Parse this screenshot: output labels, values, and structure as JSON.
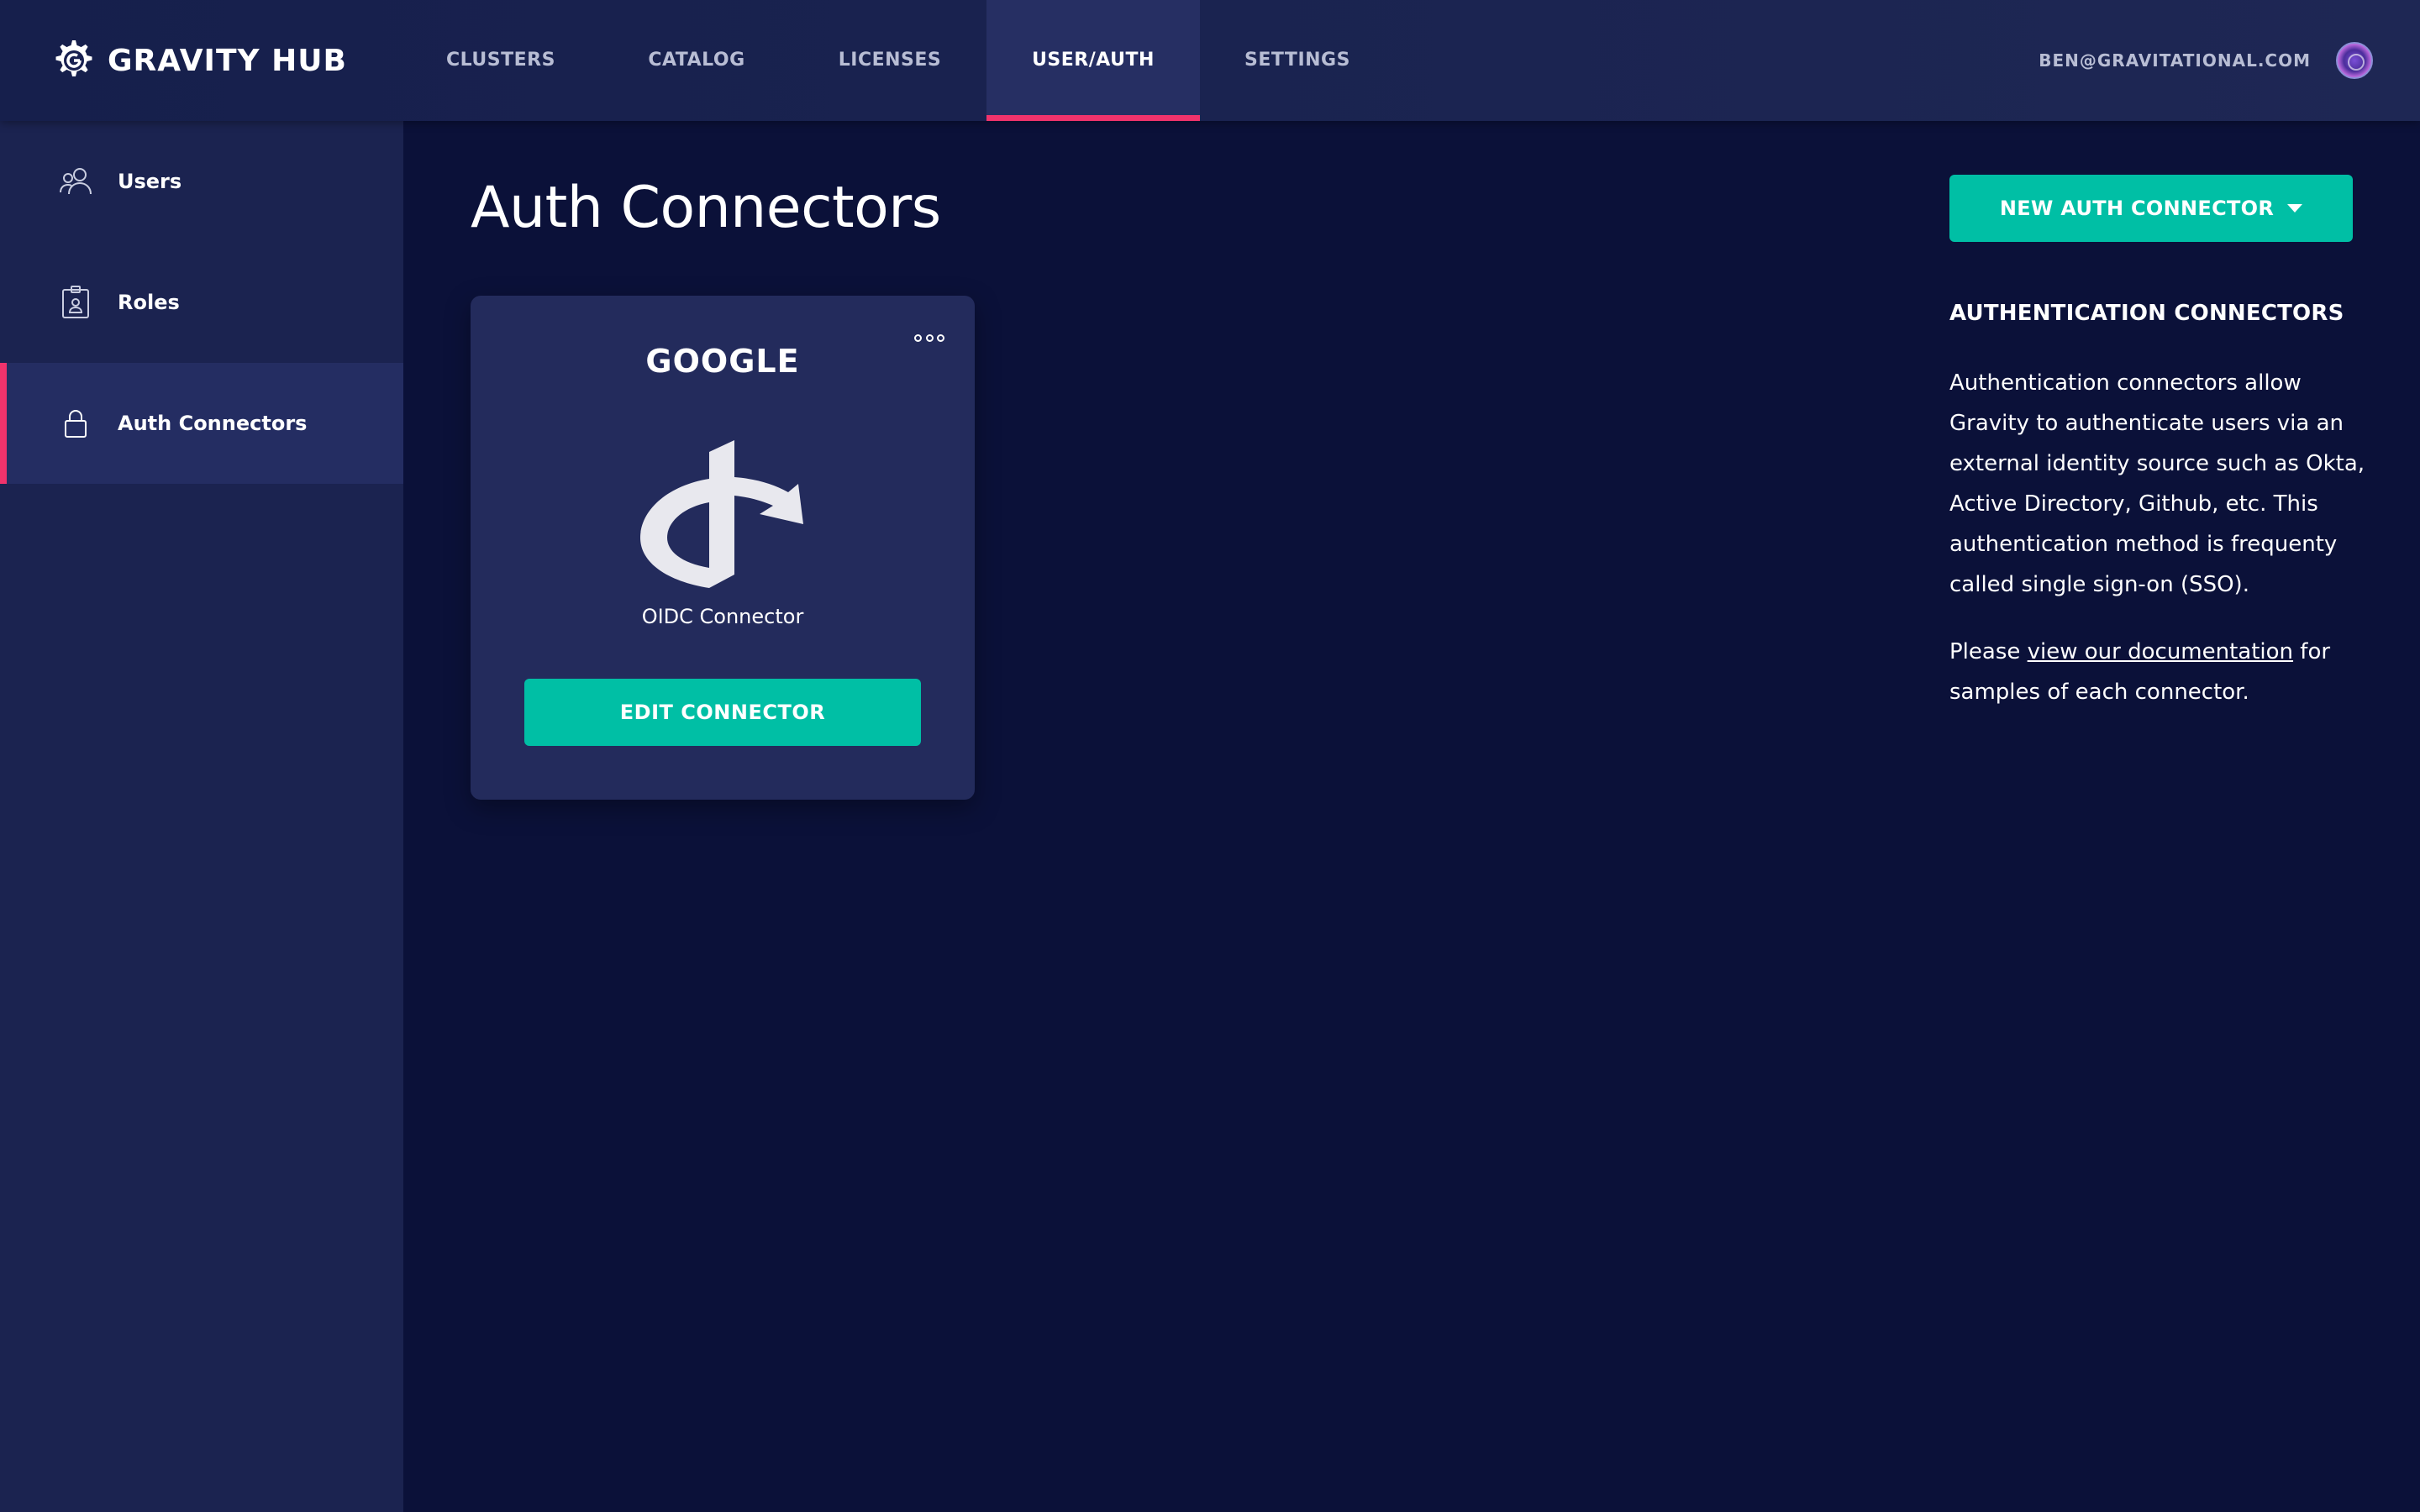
{
  "brand": {
    "name": "GRAVITY HUB",
    "logo_icon": "gear-logo-icon"
  },
  "nav": {
    "tabs": [
      {
        "label": "CLUSTERS",
        "active": false
      },
      {
        "label": "CATALOG",
        "active": false
      },
      {
        "label": "LICENSES",
        "active": false
      },
      {
        "label": "USER/AUTH",
        "active": true
      },
      {
        "label": "SETTINGS",
        "active": false
      }
    ],
    "user_email": "BEN@GRAVITATIONAL.COM"
  },
  "sidebar": {
    "items": [
      {
        "label": "Users",
        "icon": "users-icon",
        "active": false
      },
      {
        "label": "Roles",
        "icon": "badge-icon",
        "active": false
      },
      {
        "label": "Auth Connectors",
        "icon": "lock-icon",
        "active": true
      }
    ]
  },
  "main": {
    "title": "Auth Connectors",
    "connector_card": {
      "name": "GOOGLE",
      "logo_icon": "openid-icon",
      "type_label": "OIDC Connector",
      "edit_label": "EDIT CONNECTOR",
      "menu_icon": "more-options-icon"
    }
  },
  "right_panel": {
    "new_button_label": "NEW AUTH CONNECTOR",
    "heading": "AUTHENTICATION CONNECTORS",
    "description": "Authentication connectors allow Gravity to authenticate users via an external identity source such as Okta, Active Directory, Github, etc. This authentication method is frequenty called single sign-on (SSO).",
    "doc_prefix": "Please ",
    "doc_link": "view our documentation",
    "doc_suffix": " for samples of each connector."
  },
  "colors": {
    "background": "#0b1139",
    "topbar": "#1a2250",
    "sidebar": "#1b2350",
    "card": "#232b5c",
    "accent_teal": "#00bfa5",
    "accent_pink": "#f0336c"
  }
}
